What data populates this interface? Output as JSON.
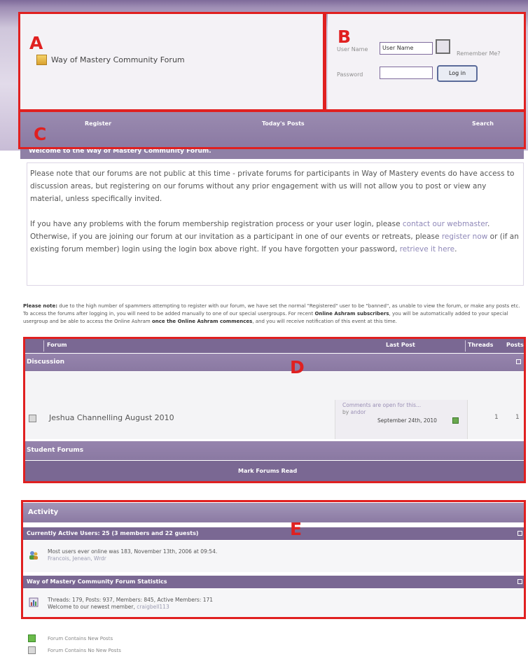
{
  "header": {
    "site_title": "Way of Mastery Community Forum"
  },
  "login": {
    "user_name_label": "User Name",
    "user_name_value": "User Name",
    "remember_label": "Remember Me?",
    "password_label": "Password",
    "password_value": "",
    "login_button": "Log in"
  },
  "nav": {
    "register": "Register",
    "todays_posts": "Today's Posts",
    "search": "Search"
  },
  "welcome": {
    "title": "Welcome to the Way of Mastery Community Forum.",
    "para1": "Please note that our forums are not public at this time - private forums for participants in Way of Mastery events do have access to discussion areas, but registering on our forums without any prior engagement with us will not allow you to post or view any material, unless specifically invited.",
    "para2_a": "If you have any problems with the forum membership registration process or your user login, please ",
    "para2_link1": "contact our webmaster",
    "para2_b": ". Otherwise, if you are joining our forum at our invitation as a participant in one of our events or retreats, please ",
    "para2_link2": "register now",
    "para2_c": " or (if an existing forum member) login using the login box above right. If you have forgotten your password, ",
    "para2_link3": "retrieve it here",
    "para2_d": "."
  },
  "notice": {
    "lead": "Please note:",
    "text1": " due to the high number of spammers attempting to register with our forum, we have set the normal \"Registered\" user to be \"banned\", as unable to view the forum, or make any posts etc. To access the forums after logging in, you will need to be added manually to one of our special usergroups. For recent ",
    "bold1": "Online Ashram subscribers",
    "text2": ", you will be automatically added to your special usergroup and be able to access the Online Ashram ",
    "bold2": "once the Online Ashram commences",
    "text3": ", and you will receive notification of this event at this time."
  },
  "forums": {
    "col_forum": "Forum",
    "col_last_post": "Last Post",
    "col_threads": "Threads",
    "col_posts": "Posts",
    "category1": "Discussion",
    "forum1_name": "Jeshua Channelling August 2010",
    "forum1_last_title": "Comments are open for this...",
    "forum1_last_by_prefix": "by ",
    "forum1_last_by": "andor",
    "forum1_last_date": "September 24th, 2010",
    "forum1_threads": "1",
    "forum1_posts": "1",
    "category2": "Student Forums",
    "mark_read": "Mark Forums Read"
  },
  "activity": {
    "title": "Activity",
    "active_users_header": "Currently Active Users: 25 (3 members and 22 guests)",
    "most_users": "Most users ever online was 183, November 13th, 2006 at 09:54.",
    "online_members": "Francois, Jenean, Wrdr",
    "stats_header": "Way of Mastery Community Forum Statistics",
    "stats_line": "Threads: 179, Posts: 937, Members: 845, Active Members: 171",
    "newest_prefix": "Welcome to our newest member, ",
    "newest_member": "craigbell113"
  },
  "legend": {
    "new_posts": "Forum Contains New Posts",
    "no_new_posts": "Forum Contains No New Posts"
  },
  "annotations": {
    "a": "A",
    "b": "B",
    "c": "C",
    "d": "D",
    "e": "E"
  },
  "colors": {
    "purple_bar": "#7a6893",
    "annotation_red": "#e02020"
  }
}
